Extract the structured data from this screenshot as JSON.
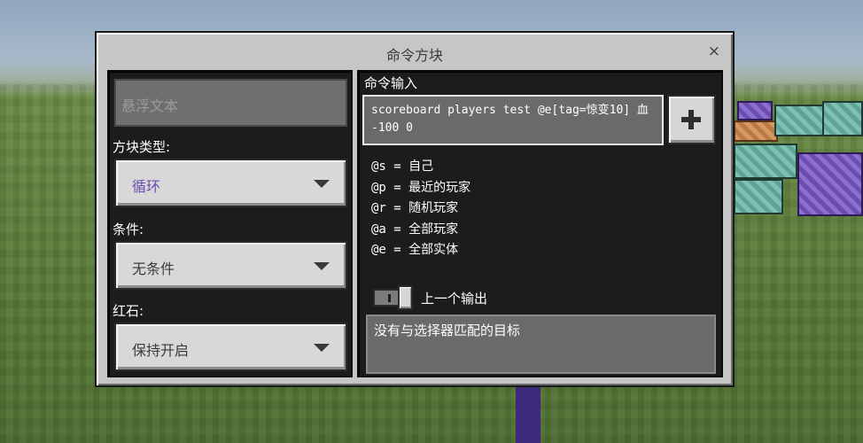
{
  "dialog": {
    "title": "命令方块",
    "close_label": "×"
  },
  "left": {
    "hover_text_placeholder": "悬浮文本",
    "block_type": {
      "label": "方块类型:",
      "value": "循环"
    },
    "condition": {
      "label": "条件:",
      "value": "无条件"
    },
    "redstone": {
      "label": "红石:",
      "value": "保持开启"
    }
  },
  "right": {
    "command_input_label": "命令输入",
    "command_text": "scoreboard players test @e[tag=惊变10] 血\n-100 0",
    "selectors": [
      "@s = 自己",
      "@p = 最近的玩家",
      "@r = 随机玩家",
      "@a = 全部玩家",
      "@e = 全部实体"
    ],
    "previous_output_label": "上一个输出",
    "previous_output_toggle": "on",
    "output_text": "没有与选择器匹配的目标"
  },
  "icons": {
    "close": "close-icon",
    "add": "plus-icon",
    "dropdown": "chevron-down-icon"
  },
  "colors": {
    "dialog_bg": "#c6c6c6",
    "panel_bg": "#1c1c1c",
    "field_bg": "#6a6a6a",
    "block_type_value": "#6a4db0"
  }
}
